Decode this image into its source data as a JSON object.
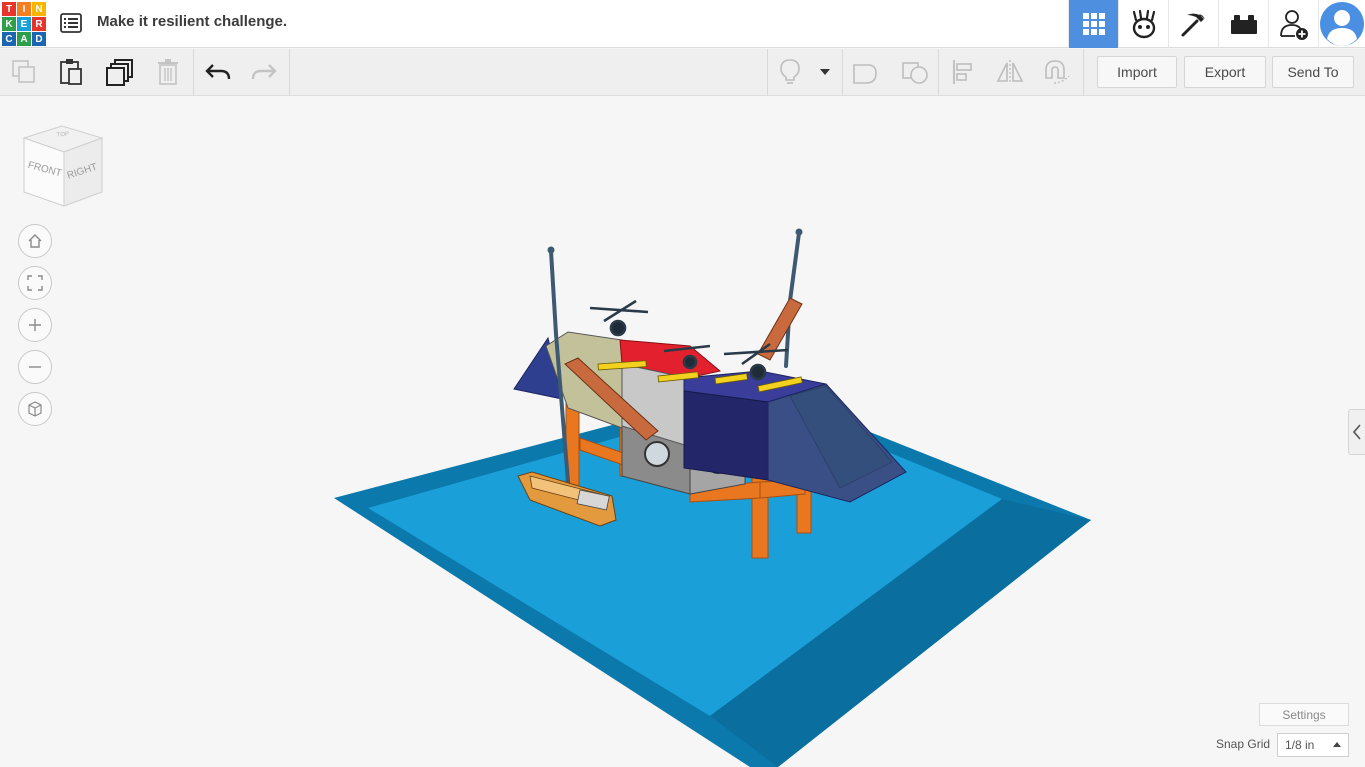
{
  "logo": {
    "letters": [
      "T",
      "I",
      "N",
      "K",
      "E",
      "R",
      "C",
      "A",
      "D"
    ],
    "colors": [
      "#e8352c",
      "#f57f20",
      "#f7b500",
      "#2d9f4a",
      "#18a0d8",
      "#e8352c",
      "#1b66b0",
      "#2d9f4a",
      "#1b66b0"
    ]
  },
  "header": {
    "title": "Make it resilient challenge."
  },
  "topbar_right": {
    "items": [
      "3D design view",
      "Blocks / sim lab",
      "Codeblocks",
      "Bricks",
      "Invite users",
      "User profile"
    ],
    "icons": [
      "grid-icon",
      "creature-icon",
      "pickaxe-icon",
      "brick-icon",
      "add-user-icon",
      "avatar-icon"
    ],
    "accent": "#4f8fe0"
  },
  "toolbar": {
    "import_label": "Import",
    "export_label": "Export",
    "send_to_label": "Send To"
  },
  "viewcube": {
    "front": "FRONT",
    "right": "RIGHT",
    "top": "TOP"
  },
  "nav": {
    "icons": [
      "home-icon",
      "fit-view-icon",
      "zoom-in-icon",
      "zoom-out-icon",
      "perspective-icon"
    ]
  },
  "bottom": {
    "settings_label": "Settings",
    "snap_grid_label": "Snap Grid",
    "snap_grid_value": "1/8 in"
  },
  "scene": {
    "water_color": "#1a9fd8",
    "water_edge_color": "#0b79ab",
    "platform_color": "#2e3f8f",
    "leg_color": "#e8771f",
    "deck_color": "#e3212e"
  }
}
